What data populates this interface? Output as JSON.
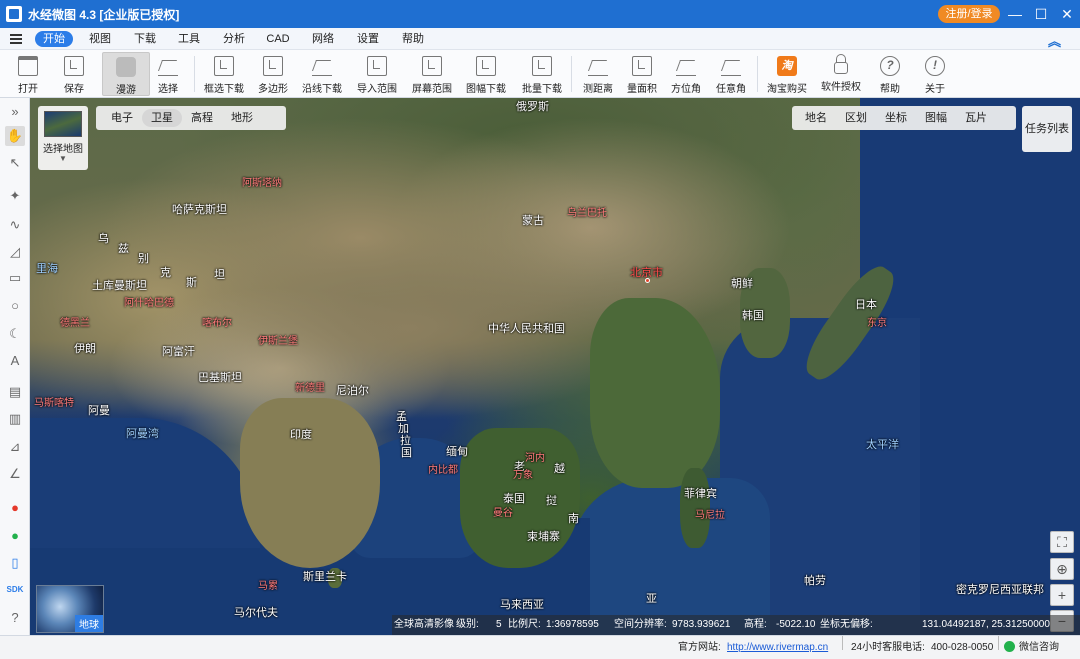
{
  "titlebar": {
    "title": "水经微图 4.3 [企业版已授权]",
    "login_label": "注册/登录",
    "min": "—",
    "max": "☐",
    "close": "✕"
  },
  "menu": {
    "items": [
      "开始",
      "视图",
      "下载",
      "工具",
      "分析",
      "CAD",
      "网络",
      "设置",
      "帮助"
    ],
    "active": "开始",
    "collapse": "︽"
  },
  "toolbar": {
    "tools": [
      {
        "label": "打开",
        "icon": "folder-icon"
      },
      {
        "label": "保存",
        "icon": "save-icon"
      },
      {
        "label": "漫游",
        "icon": "hand-icon",
        "active": true
      },
      {
        "label": "选择",
        "icon": "cursor-icon"
      },
      {
        "label": "框选下载",
        "icon": "box-download-icon"
      },
      {
        "label": "多边形",
        "icon": "polygon-download-icon"
      },
      {
        "label": "沿线下载",
        "icon": "line-download-icon"
      },
      {
        "label": "导入范围",
        "icon": "import-range-icon"
      },
      {
        "label": "屏幕范围",
        "icon": "screen-range-icon"
      },
      {
        "label": "图幅下载",
        "icon": "sheet-download-icon"
      },
      {
        "label": "批量下载",
        "icon": "batch-download-icon"
      },
      {
        "label": "测距离",
        "icon": "ruler-icon"
      },
      {
        "label": "量面积",
        "icon": "area-icon"
      },
      {
        "label": "方位角",
        "icon": "azimuth-icon"
      },
      {
        "label": "任意角",
        "icon": "angle-icon"
      },
      {
        "label": "淘宝购买",
        "icon": "taobao-icon"
      },
      {
        "label": "软件授权",
        "icon": "lock-icon"
      },
      {
        "label": "帮助",
        "icon": "help-icon"
      },
      {
        "label": "关于",
        "icon": "info-icon"
      }
    ],
    "taobao_glyph": "淘",
    "help_glyph": "?",
    "info_glyph": "!"
  },
  "left_tools": [
    {
      "name": "expand-icon",
      "glyph": "»"
    },
    {
      "name": "hand-icon",
      "glyph": "✋"
    },
    {
      "name": "cursor-icon",
      "glyph": "↖"
    },
    {
      "name": "marker-icon",
      "glyph": "✦"
    },
    {
      "name": "polyline-icon",
      "glyph": "∿"
    },
    {
      "name": "area-draw-icon",
      "glyph": "◿"
    },
    {
      "name": "rectangle-icon",
      "glyph": "▭"
    },
    {
      "name": "circle-icon",
      "glyph": "○"
    },
    {
      "name": "crescent-icon",
      "glyph": "☾"
    },
    {
      "name": "text-icon",
      "glyph": "A"
    },
    {
      "name": "measure-icon",
      "glyph": "▤"
    },
    {
      "name": "area-measure-icon",
      "glyph": "▥"
    },
    {
      "name": "azimuth-icon",
      "glyph": "⊿"
    },
    {
      "name": "angle-icon",
      "glyph": "∠"
    },
    {
      "name": "weibo-icon",
      "glyph": "●"
    },
    {
      "name": "wechat-icon",
      "glyph": "●"
    },
    {
      "name": "phone-icon",
      "glyph": "▯"
    },
    {
      "name": "sdk-icon",
      "glyph": "SDK"
    },
    {
      "name": "help-icon",
      "glyph": "?"
    }
  ],
  "map": {
    "source_panel": [
      "电子",
      "卫星",
      "高程",
      "地形"
    ],
    "source_active": "卫星",
    "layer_panel": [
      "地名",
      "区划",
      "坐标",
      "图幅",
      "瓦片"
    ],
    "select_map_label": "选择地图",
    "select_map_arrow": "▼",
    "task_list": "任务列表",
    "globe_label": "地球",
    "zoom_buttons": [
      "⛶",
      "⊕",
      "+",
      "−"
    ],
    "labels": [
      {
        "text": "俄罗斯",
        "style": "big"
      },
      {
        "text": "哈萨克斯坦",
        "style": "big"
      },
      {
        "text": "阿斯塔纳",
        "style": "red"
      },
      {
        "text": "蒙古",
        "style": "big"
      },
      {
        "text": "乌兰巴托",
        "style": "red"
      },
      {
        "text": "乌",
        "style": "big"
      },
      {
        "text": "兹",
        "style": "big"
      },
      {
        "text": "别",
        "style": "big"
      },
      {
        "text": "克",
        "style": "big"
      },
      {
        "text": "斯",
        "style": "big"
      },
      {
        "text": "坦",
        "style": "big"
      },
      {
        "text": "土库曼斯坦",
        "style": "big"
      },
      {
        "text": "阿什哈巴德",
        "style": "red"
      },
      {
        "text": "里海",
        "style": "ocean-l"
      },
      {
        "text": "德黑兰",
        "style": "red"
      },
      {
        "text": "喀布尔",
        "style": "red"
      },
      {
        "text": "伊朗",
        "style": "big"
      },
      {
        "text": "阿富汗",
        "style": "big"
      },
      {
        "text": "伊斯兰堡",
        "style": "red"
      },
      {
        "text": "巴基斯坦",
        "style": "big"
      },
      {
        "text": "中华人民共和国",
        "style": "big"
      },
      {
        "text": "北京市",
        "style": "cap"
      },
      {
        "text": "朝鲜",
        "style": "big"
      },
      {
        "text": "韩国",
        "style": "big"
      },
      {
        "text": "日本",
        "style": "big"
      },
      {
        "text": "东京",
        "style": "red"
      },
      {
        "text": "新德里",
        "style": "red"
      },
      {
        "text": "尼泊尔",
        "style": "big"
      },
      {
        "text": "孟",
        "style": "big"
      },
      {
        "text": "加",
        "style": "big"
      },
      {
        "text": "拉",
        "style": "big"
      },
      {
        "text": "国",
        "style": "big"
      },
      {
        "text": "印度",
        "style": "big"
      },
      {
        "text": "缅甸",
        "style": "big"
      },
      {
        "text": "内比都",
        "style": "red"
      },
      {
        "text": "河内",
        "style": "red"
      },
      {
        "text": "老",
        "style": "big"
      },
      {
        "text": "万象",
        "style": "red"
      },
      {
        "text": "泰国",
        "style": "big"
      },
      {
        "text": "挝",
        "style": "big"
      },
      {
        "text": "曼谷",
        "style": "red"
      },
      {
        "text": "南",
        "style": "big"
      },
      {
        "text": "柬埔寨",
        "style": "big"
      },
      {
        "text": "越",
        "style": "big"
      },
      {
        "text": "菲律宾",
        "style": "big"
      },
      {
        "text": "马尼拉",
        "style": "red"
      },
      {
        "text": "太平洋",
        "style": "ocean-l"
      },
      {
        "text": "阿曼湾",
        "style": "ocean-l"
      },
      {
        "text": "阿曼",
        "style": "big"
      },
      {
        "text": "马斯喀特",
        "style": "red"
      },
      {
        "text": "马累",
        "style": "red"
      },
      {
        "text": "斯里兰卡",
        "style": "big"
      },
      {
        "text": "马尔代夫",
        "style": "big"
      },
      {
        "text": "马来西亚",
        "style": "big"
      },
      {
        "text": "亚",
        "style": "big"
      },
      {
        "text": "帕劳",
        "style": "big"
      },
      {
        "text": "密克罗尼西亚联邦",
        "style": "big"
      }
    ]
  },
  "map_status": {
    "imagery": "全球高清影像",
    "level_label": "级别:",
    "level_value": "5",
    "scale_label": "比例尺:",
    "scale_value": "1:36978595",
    "resolution_label": "空间分辨率:",
    "resolution_value": "9783.939621",
    "elevation_label": "高程:",
    "elevation_value": "-5022.10",
    "coord_label": "坐标无偏移:",
    "coord_value": "131.04492187, 25.31250000"
  },
  "statusbar": {
    "site_label": "官方网站:",
    "site_url": "http://www.rivermap.cn",
    "service_label": "24小时客服电话:",
    "phone": "400-028-0050",
    "wechat": "微信咨询"
  }
}
